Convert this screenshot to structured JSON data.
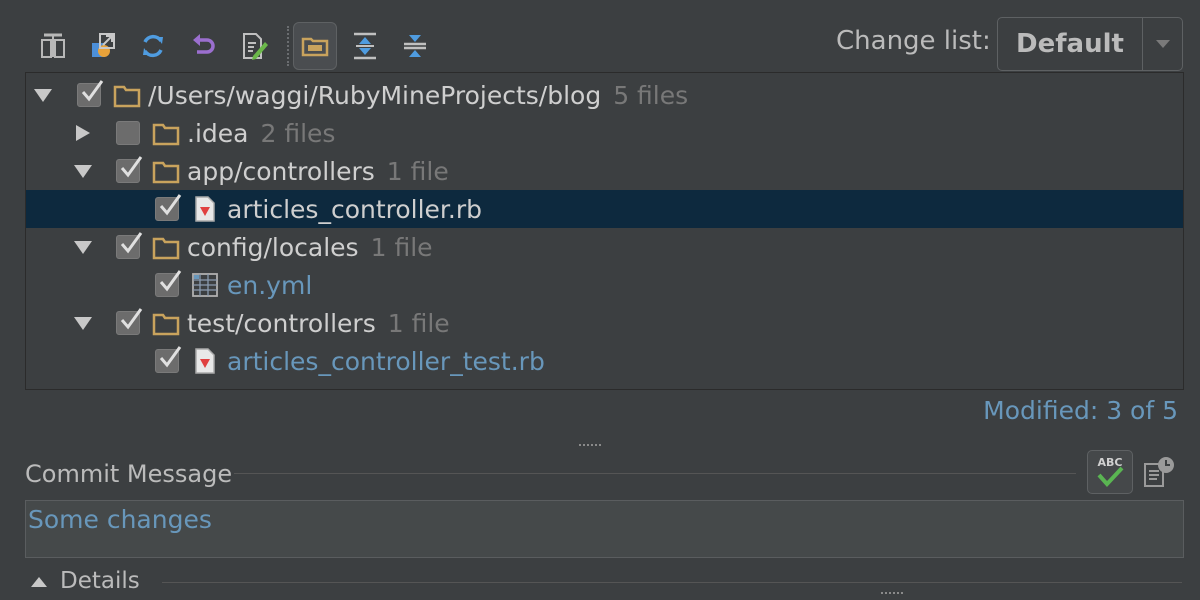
{
  "toolbar": {
    "buttons": [
      {
        "icon": "diff-icon"
      },
      {
        "icon": "move-to-changelist-icon"
      },
      {
        "icon": "refresh-icon"
      },
      {
        "icon": "rollback-icon"
      },
      {
        "icon": "edit-source-icon"
      },
      {
        "icon": "group-by-directory-icon",
        "active": true
      },
      {
        "icon": "expand-all-icon"
      },
      {
        "icon": "collapse-all-icon"
      }
    ]
  },
  "changelist": {
    "label": "Change list:",
    "value": "Default"
  },
  "tree": {
    "rows": [
      {
        "label": "/Users/waggi/RubyMineProjects/blog",
        "count": "5 files",
        "expanded": true,
        "checked": true
      },
      {
        "label": ".idea",
        "count": "2 files",
        "expanded": false,
        "checked": false
      },
      {
        "label": "app/controllers",
        "count": "1 file",
        "expanded": true,
        "checked": true
      },
      {
        "label": "articles_controller.rb",
        "checked": true,
        "selected": true
      },
      {
        "label": "config/locales",
        "count": "1 file",
        "expanded": true,
        "checked": true
      },
      {
        "label": "en.yml",
        "checked": true
      },
      {
        "label": "test/controllers",
        "count": "1 file",
        "expanded": true,
        "checked": true
      },
      {
        "label": "articles_controller_test.rb",
        "checked": true
      }
    ]
  },
  "status": {
    "modified": "Modified: 3 of 5"
  },
  "commit": {
    "label": "Commit Message",
    "message": "Some changes",
    "spell_badge": "ABC"
  },
  "details": {
    "label": "Details"
  },
  "colors": {
    "background": "#3c3f41",
    "selection": "#0d293e",
    "link_blue": "#6897bb",
    "folder": "#c9a35d",
    "ruby_red": "#e04040"
  }
}
